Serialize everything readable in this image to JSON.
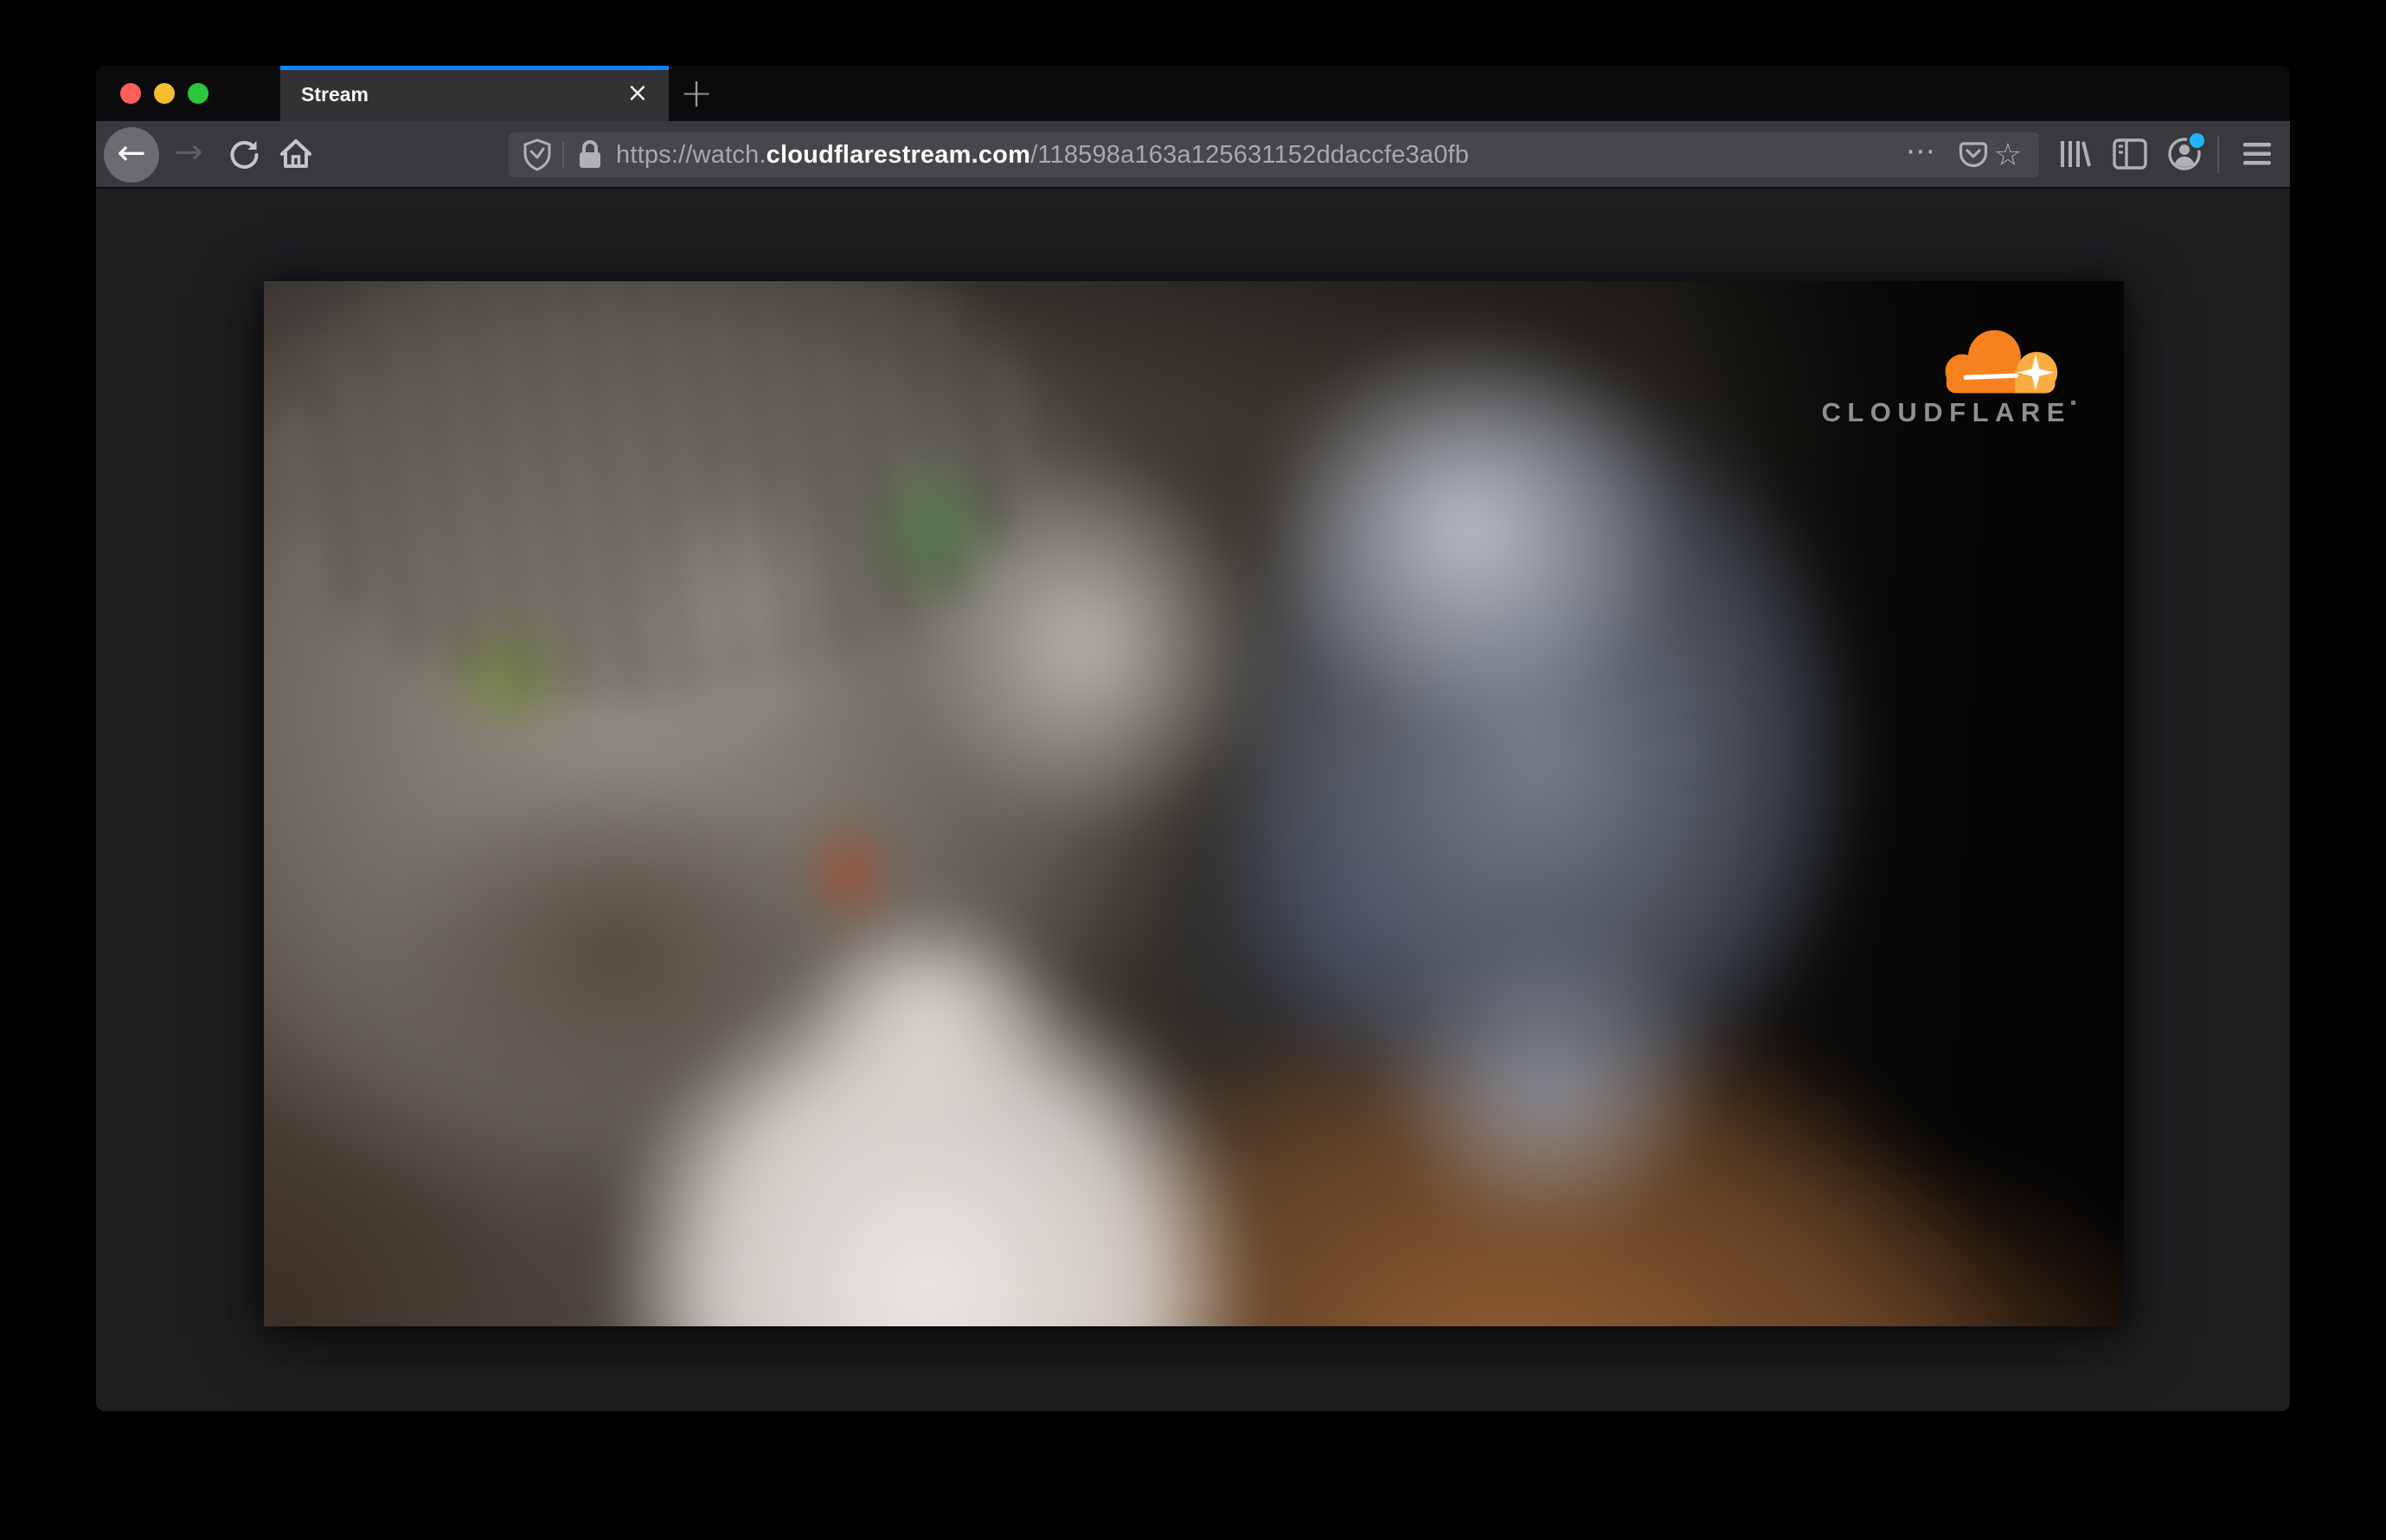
{
  "browser": {
    "tab": {
      "title": "Stream",
      "close_icon": "×"
    },
    "new_tab_icon": "+",
    "nav": {
      "back_icon": "←",
      "forward_icon": "→"
    },
    "url": {
      "prefix": "https://watch.",
      "domain": "cloudflarestream.com",
      "path": "/118598a163a125631152ddaccfe3a0fb"
    },
    "page_actions_icon": "⋯",
    "star_icon": "☆",
    "icon_names": [
      "shield-icon",
      "lock-icon",
      "reload-icon",
      "home-icon",
      "pocket-icon",
      "library-icon",
      "sidebar-icon",
      "account-icon",
      "menu-icon"
    ]
  },
  "page": {
    "logo_text": "CLOUDFLARE"
  },
  "colors": {
    "tab_accent_blue": "#0a84ff",
    "notification_dot_blue": "#1fb6ff",
    "cloudflare_orange": "#f6821f",
    "cloudflare_orange_light": "#fbad41",
    "logo_text_gray": "#8f8f91",
    "traffic_red": "#ff5f58",
    "traffic_yellow": "#f5bd30",
    "traffic_green": "#2bc63f"
  }
}
